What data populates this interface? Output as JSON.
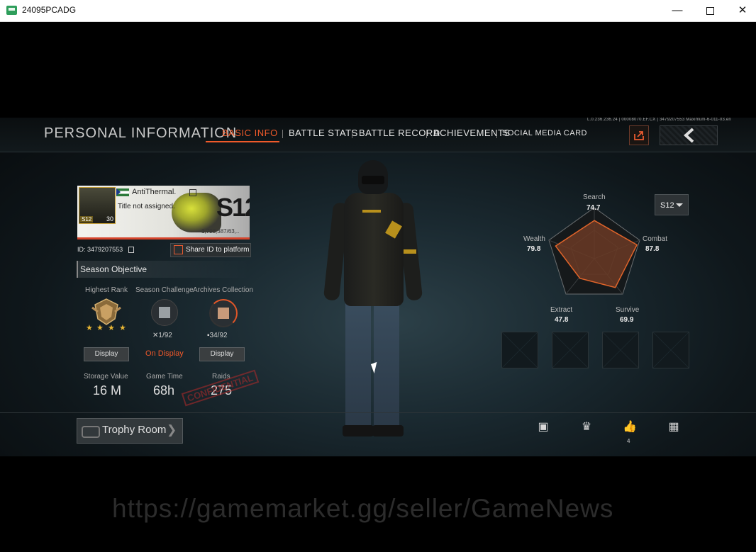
{
  "window": {
    "title": "24095PCADG"
  },
  "header": {
    "page_title": "PERSONAL INFORMATION",
    "tiny_id": "L.0.236.236.24 | 00008070.EF.CX | 3479207553 Maximum-6-011-03.en",
    "tabs": [
      {
        "label": "BASIC INFO",
        "active": true
      },
      {
        "label": "BATTLE STATS",
        "active": false
      },
      {
        "label": "BATTLE RECORD",
        "active": false
      },
      {
        "label": "ACHIEVEMENTS",
        "active": false
      },
      {
        "label": "SOCIAL MEDIA CARD",
        "active": false
      }
    ]
  },
  "profile": {
    "name": "AntiThermal.",
    "title": "Title not assigned.",
    "level": "30",
    "season_tag": "S12",
    "card_season": "S12",
    "card_coins": "1,798,387/63,..",
    "id_label": "ID:",
    "id_value": "3479207553",
    "share_label": "Share ID to platform"
  },
  "season_objective": {
    "title": "Season Objective",
    "highest_rank_label": "Highest Rank",
    "challenge_label": "Season Challenge",
    "archives_label": "Archives Collection",
    "challenge_count": "1/92",
    "archives_count": "34/92",
    "display_label": "Display",
    "on_display_label": "On Display",
    "stars": 4
  },
  "stats": {
    "storage_label": "Storage Value",
    "storage_value": "16 M",
    "game_time_label": "Game Time",
    "game_time_value": "68h",
    "raids_label": "Raids",
    "raids_value": "275",
    "confidential": "CONFIDENTIAL"
  },
  "trophy": {
    "label": "Trophy Room"
  },
  "radar": {
    "season": "S12",
    "axes": [
      {
        "label": "Search",
        "value": "74.7"
      },
      {
        "label": "Combat",
        "value": "87.8"
      },
      {
        "label": "Survive",
        "value": "69.9"
      },
      {
        "label": "Extract",
        "value": "47.8"
      },
      {
        "label": "Wealth",
        "value": "79.8"
      }
    ],
    "accent": "#e0642a"
  },
  "bottom_bar": {
    "likes": "4"
  },
  "watermark": "https://gamemarket.gg/seller/GameNews"
}
